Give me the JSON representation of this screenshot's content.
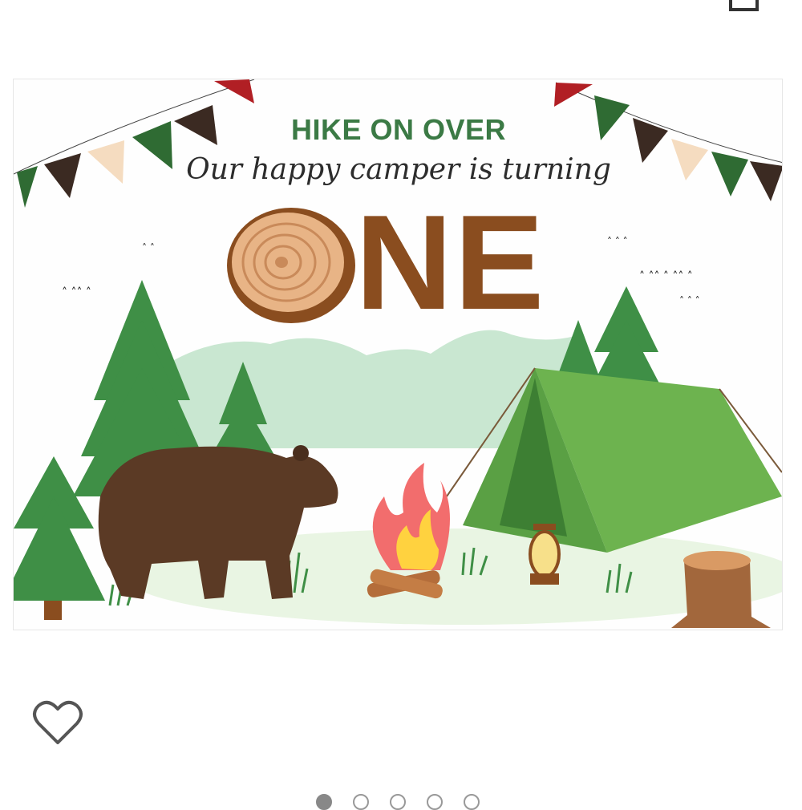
{
  "product_image": {
    "headline": "HIKE ON OVER",
    "script_line": "Our happy camper is turning",
    "big_word": "NE",
    "alt_icon": "log-slice-icon"
  },
  "actions": {
    "favorite_icon": "heart-outline-icon"
  },
  "carousel": {
    "dot_count": 5,
    "active_index": 0
  },
  "colors": {
    "headline_green": "#3b7a45",
    "one_brown": "#8a4d1f",
    "tent_green": "#6db34f",
    "tree_green": "#3f8f46",
    "bear_brown": "#5b3a25"
  }
}
